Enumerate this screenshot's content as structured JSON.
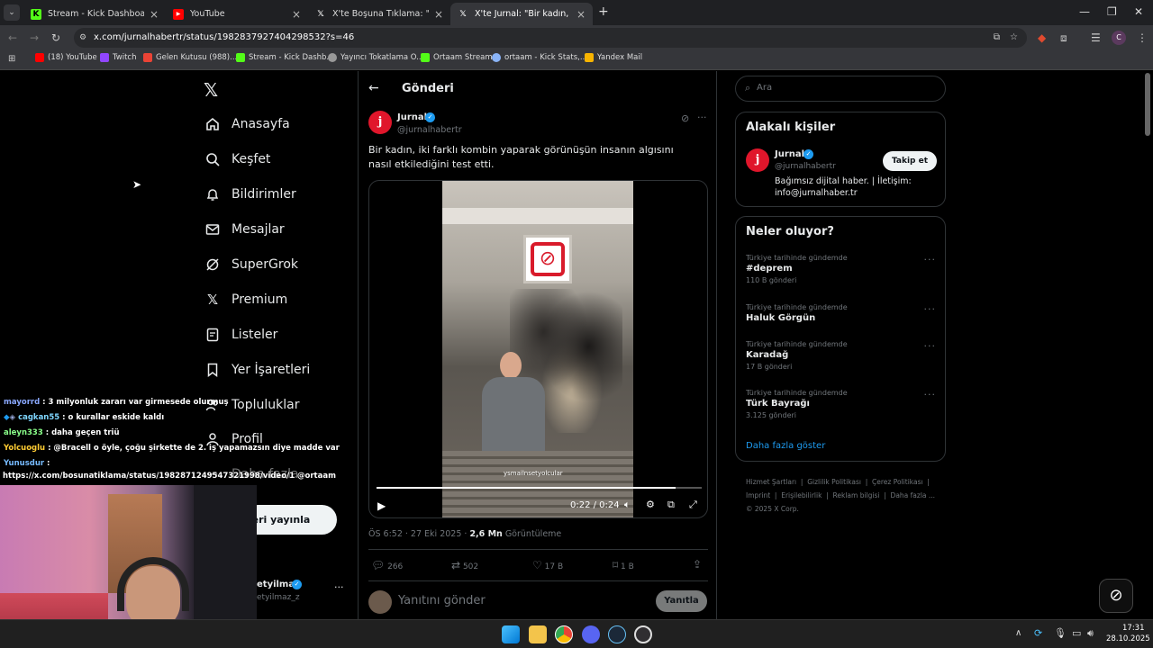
{
  "browser": {
    "tabs": [
      {
        "title": "Stream - Kick Dashboard",
        "active": false
      },
      {
        "title": "YouTube",
        "active": false
      },
      {
        "title": "X'te Boşuna Tıklama: \"Düzce'de",
        "active": false
      },
      {
        "title": "X'te Jurnal: \"Bir kadın, iki farklı k",
        "active": true
      }
    ],
    "new_tab": "+",
    "url": "x.com/jurnalhabertr/status/1982837927404298532?s=46",
    "bookmarks": [
      "(18) YouTube",
      "Twitch",
      "Gelen Kutusu (988)...",
      "Stream - Kick Dashb...",
      "Yayıncı Tokatlama O...",
      "Ortaam Stream",
      "ortaam - Kick Stats,...",
      "Yandex Mail"
    ]
  },
  "sidebar": {
    "items": [
      {
        "label": "Anasayfa",
        "icon": "home-icon"
      },
      {
        "label": "Keşfet",
        "icon": "search-icon"
      },
      {
        "label": "Bildirimler",
        "icon": "bell-icon"
      },
      {
        "label": "Mesajlar",
        "icon": "mail-icon"
      },
      {
        "label": "SuperGrok",
        "icon": "grok-icon"
      },
      {
        "label": "Premium",
        "icon": "x-icon"
      },
      {
        "label": "Listeler",
        "icon": "list-icon"
      },
      {
        "label": "Yer İşaretleri",
        "icon": "bookmark-icon"
      },
      {
        "label": "Topluluklar",
        "icon": "people-icon"
      },
      {
        "label": "Profil",
        "icon": "person-icon"
      },
      {
        "label": "Daha fazla",
        "icon": "more-icon"
      }
    ],
    "post_button": "eri yayınla",
    "account": {
      "name": "etyilmaz",
      "handle": "etyilmaz_z"
    }
  },
  "post": {
    "header": "Gönderi",
    "author_name": "Jurnal",
    "author_handle": "@jurnalhabertr",
    "text": "Bir kadın, iki farklı kombin yaparak görünüşün insanın algısını nasıl etkilediğini test etti.",
    "video_time": "0:22 / 0:24",
    "video_progress": 0.92,
    "video_watermark": "ysmailnsetyolcular",
    "time": "ÖS 6:52 · 27 Eki 2025 · ",
    "views": "2,6 Mn",
    "views_label": " Görüntüleme",
    "stats": {
      "replies": "266",
      "reposts": "502",
      "likes": "17 B",
      "bookmarks": "1 B"
    },
    "reply_placeholder": "Yanıtını gönder",
    "reply_button": "Yanıtla"
  },
  "right": {
    "search_placeholder": "Ara",
    "related_title": "Alakalı kişiler",
    "related": {
      "name": "Jurnal",
      "handle": "@jurnalhabertr",
      "bio": "Bağımsız dijital haber. | İletişim: info@jurnalhaber.tr",
      "follow": "Takip et"
    },
    "trends_title": "Neler oluyor?",
    "trends": [
      {
        "meta": "Türkiye tarihinde gündemde",
        "name": "#deprem",
        "count": "110 B gönderi"
      },
      {
        "meta": "Türkiye tarihinde gündemde",
        "name": "Haluk Görgün",
        "count": ""
      },
      {
        "meta": "Türkiye tarihinde gündemde",
        "name": "Karadağ",
        "count": "17 B gönderi"
      },
      {
        "meta": "Türkiye tarihinde gündemde",
        "name": "Türk Bayrağı",
        "count": "3.125 gönderi"
      }
    ],
    "show_more": "Daha fazla göster",
    "footer_line1": [
      "Hizmet Şartları",
      "Gizlilik Politikası",
      "Çerez Politikası"
    ],
    "footer_line2": [
      "Imprint",
      "Erişilebilirlik",
      "Reklam bilgisi",
      "Daha fazla ..."
    ],
    "copyright": "© 2025 X Corp."
  },
  "chat": [
    {
      "user": "mayorrd",
      "msg": " : 3 milyonluk zararı var girmesede olurmuş",
      "color": "#8aa8ff"
    },
    {
      "user": "cagkan55",
      "msg": " : o kurallar eskide kaldı",
      "color": "#7fd6ff"
    },
    {
      "user": "aleyn333",
      "msg": " : daha geçen triü",
      "color": "#8aff8a"
    },
    {
      "user": "Yolcuoglu",
      "msg": " : @Bracell o öyle, çoğu şirkette de 2. iş yapamazsın diye madde var",
      "color": "#ffcc33"
    },
    {
      "user": "Yunusdur",
      "msg": " :",
      "color": "#77bbff"
    },
    {
      "user": "",
      "msg": "https://x.com/bosunatiklama/status/1982871249547321998/video/1 @ortaam",
      "color": "#ffffff"
    }
  ],
  "taskbar": {
    "time": "17:31",
    "date": "28.10.2025"
  },
  "colors": {
    "accent": "#1d9bf0",
    "jurnal": "#e0162b",
    "kick": "#53fc18"
  }
}
